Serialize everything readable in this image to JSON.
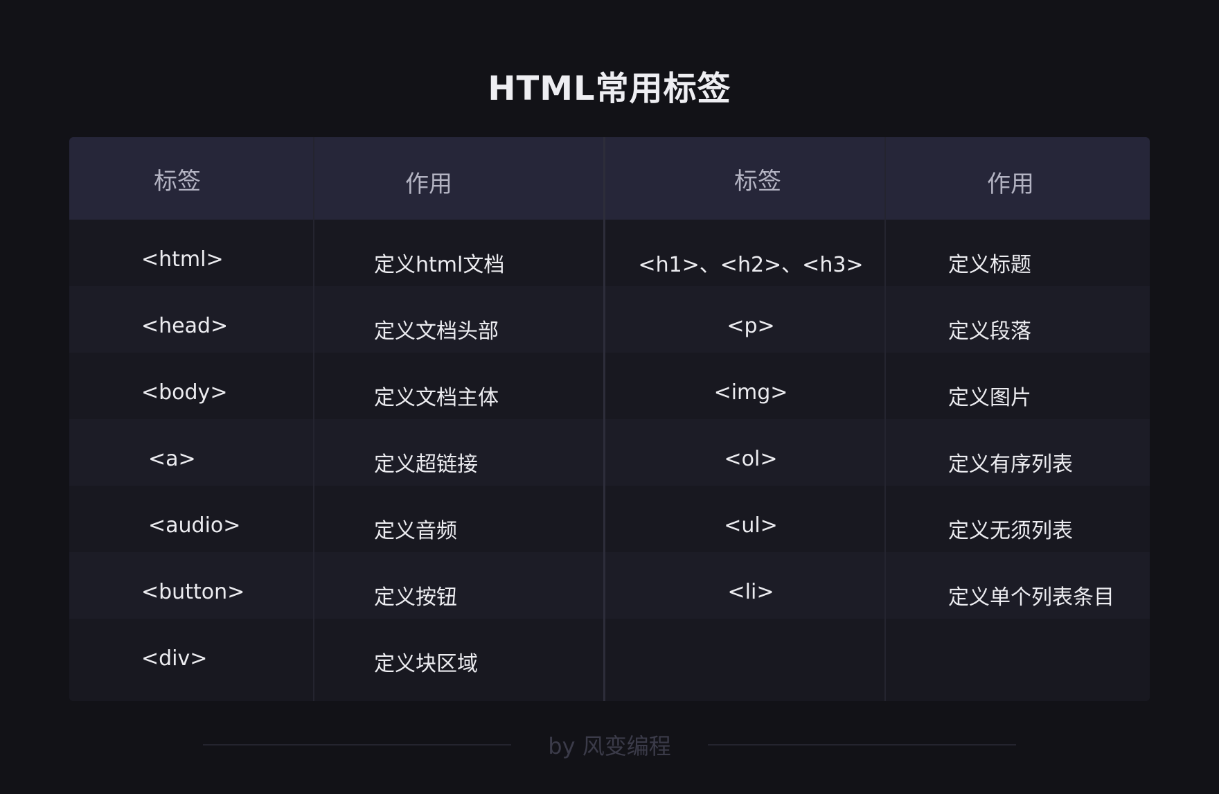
{
  "title": "HTML常用标签",
  "headers": [
    "标签",
    "作用",
    "标签",
    "作用"
  ],
  "rows": [
    {
      "tag1": "<html>",
      "desc1": "定义html文档",
      "tag2": "<h1>、<h2>、<h3>",
      "desc2": "定义标题"
    },
    {
      "tag1": "<head>",
      "desc1": "定义文档头部",
      "tag2": "<p>",
      "desc2": "定义段落"
    },
    {
      "tag1": "<body>",
      "desc1": "定义文档主体",
      "tag2": "<img>",
      "desc2": "定义图片"
    },
    {
      "tag1": "<a>",
      "desc1": "定义超链接",
      "tag2": "<ol>",
      "desc2": "定义有序列表"
    },
    {
      "tag1": "<audio>",
      "desc1": "定义音频",
      "tag2": "<ul>",
      "desc2": "定义无须列表"
    },
    {
      "tag1": "<button>",
      "desc1": "定义按钮",
      "tag2": "<li>",
      "desc2": "定义单个列表条目"
    },
    {
      "tag1": "<div>",
      "desc1": "定义块区域",
      "tag2": "",
      "desc2": ""
    }
  ],
  "footer": "by 风变编程"
}
